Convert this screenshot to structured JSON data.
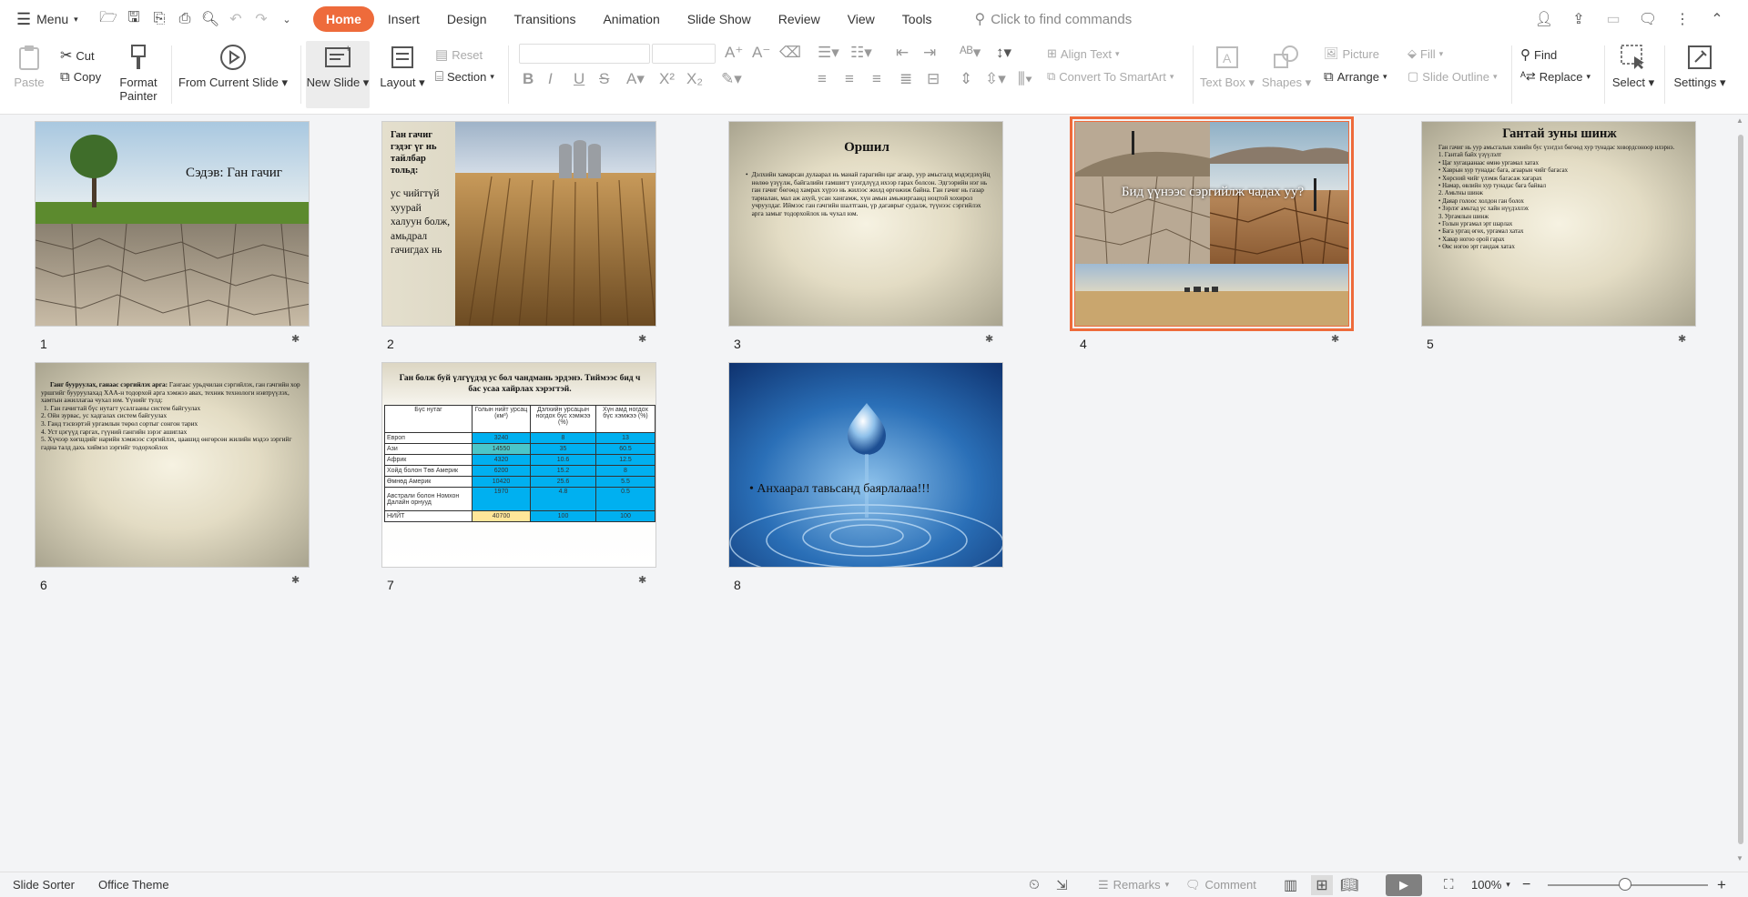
{
  "menubar": {
    "menu_label": "Menu",
    "tabs": [
      "Home",
      "Insert",
      "Design",
      "Transitions",
      "Animation",
      "Slide Show",
      "Review",
      "View",
      "Tools"
    ],
    "active_tab": "Home",
    "search_placeholder": "Click to find commands"
  },
  "ribbon": {
    "paste": "Paste",
    "cut": "Cut",
    "copy": "Copy",
    "format_painter_1": "Format",
    "format_painter_2": "Painter",
    "from_current_slide": "From Current Slide",
    "new_slide": "New Slide",
    "layout": "Layout",
    "reset": "Reset",
    "section": "Section",
    "align_text": "Align Text",
    "convert_smartart": "Convert To SmartArt",
    "text_box": "Text Box",
    "shapes": "Shapes",
    "picture": "Picture",
    "arrange": "Arrange",
    "fill": "Fill",
    "slide_outline": "Slide Outline",
    "find": "Find",
    "replace": "Replace",
    "select": "Select",
    "settings": "Settings"
  },
  "slides": [
    {
      "number": "1",
      "title": "Сэдэв: Ган гачиг"
    },
    {
      "number": "2",
      "title": "Ган гачиг гэдэг үг нь тайлбар тольд:",
      "body": "ус чийгтүй хуурай халуун болж, амьдрал гачигдах нь"
    },
    {
      "number": "3",
      "title": "Оршил",
      "body": "Дэлхийн хамарсан дулаарал нь манай гарагийн цаг агаар, уур амьсгалд мэдэгдэхүйц нөлөө үзүүлж, байгалийн гамшигт үзэгдлүүд ихээр гарах болсон. Эдгээрийн нэг нь ган гачиг бөгөөд хамрах хүрээ нь жилээс жилд өргөжиж байна. Ган гачиг нь газар тариалан, мал аж ахуй, усан хангамж, хүн амын амьжиргаанд ноцтой хохирол учруулдаг. Иймээс ган гачгийн шалтгаан, үр дагаврыг судалж, түүнээс сэргийлэх арга замыг тодорхойлох нь чухал юм."
    },
    {
      "number": "4",
      "title": "Бид үүнээс сэргийлж чадах уу?"
    },
    {
      "number": "5",
      "title": "Гантай зуны шинж",
      "items": [
        "Ган гачиг нь уур амьсгалын хэвийн бус үзэгдэл бөгөөд хур тунадас ховордсоноор илэрнэ.",
        "1. Гантай байх үзүүлэлт",
        "• Цаг хугацаанаас өмнө ургамал хатах",
        "• Хаврын хур тунадас бага, агаарын чийг багасах",
        "• Хөрсний чийг үлэмж багасаж хагарах",
        "• Намар, өвлийн хур тунадас бага байвал",
        "2. Амьтны шинж",
        "• Даяар голоос холдон ган болох",
        "• Зэрлэг амьтад ус хайн нүүдэллэх",
        "3. Ургамлын шинж",
        "• Голын ургамал эрт шарлах",
        "• Бага ургац өгөх, ургамал хатах",
        "• Хавар ногоо орой гарах",
        "• Өвс ногоо эрт гандаж хатах"
      ]
    },
    {
      "number": "6",
      "lead": "Ганг бууруулах, ганаас сэргийлэх арга:",
      "lead_rest": " Гангаас урьдчилан сэргийлэх, ган гачгийн хор уршгийг бууруулахад ХАА-н тодорхой арга хэмжээ авах, техник технологи нэвтрүүлэх, хамтын ажиллагаа чухал юм. Үүнийг тулд:",
      "items": [
        "1. Ган гачигтай бүс нутагт усалгааны систем байгуулах",
        "2. Ойн зурвас, ус хадгалах систем байгуулах",
        "3. Ганд тэсвэртэй ургамлын төрөл сортыг сонгон тарих",
        "4. Уст цэгүүд гаргах, гүүний гангийн зэрэг ашиглах",
        "5. Хүчээр хөгшдийг нарийн хэмжээс сэргийлэх, цаашид өнгөрсөн жилийн мэдээ зэргийг гадна талд дахь хиймэл зэргийг тодорхойлох"
      ]
    },
    {
      "number": "7",
      "title": "Ган болж буй үлгүүдэд ус бол чандмань эрдэнэ. Тиймээс бид ч бас усаа хайрлах хэрэгтэй.",
      "table": {
        "headers": [
          "Бүс нутаг",
          "Голын нийт урсац (км³)",
          "Дэлхийн урсацын ногдох бүс хэмжээ (%)",
          "Хүн амд ногдох бүс хэмжээ (%)"
        ],
        "rows": [
          [
            "Европ",
            "3240",
            "8",
            "13"
          ],
          [
            "Ази",
            "14550",
            "35",
            "60.5"
          ],
          [
            "Африк",
            "4320",
            "10.6",
            "12.5"
          ],
          [
            "Хойд болон Төв Америк",
            "6200",
            "15.2",
            "8"
          ],
          [
            "Өмнөд Америк",
            "10420",
            "25.6",
            "5.5"
          ],
          [
            "Австрали болон Номхон Далайн орнууд",
            "1970",
            "4.8",
            "0.5"
          ],
          [
            "НИЙТ",
            "40700",
            "100",
            "100"
          ]
        ]
      }
    },
    {
      "number": "8",
      "title": "• Анхаарал тавьсанд баярлалаа!!!"
    }
  ],
  "statusbar": {
    "view_name": "Slide Sorter",
    "theme": "Office Theme",
    "remarks": "Remarks",
    "comment": "Comment",
    "zoom": "100%"
  },
  "colors": {
    "accent": "#ee6b3b",
    "table_blue": "#00b0f0",
    "table_yellow": "#ffe699"
  }
}
